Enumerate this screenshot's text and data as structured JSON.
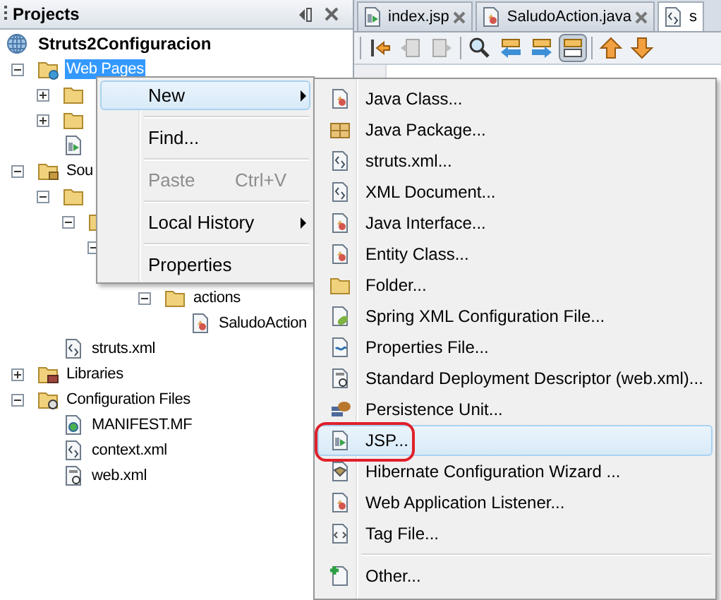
{
  "panel": {
    "title": "Projects"
  },
  "tree": [
    {
      "label": "Struts2Configuracion",
      "kind": "project",
      "selected": false,
      "children": [
        {
          "label": "Web Pages",
          "kind": "web-folder",
          "selected": true,
          "expanded": true,
          "children": [
            {
              "kind": "folder",
              "expanded": false
            },
            {
              "kind": "folder",
              "expanded": false
            },
            {
              "kind": "jsp"
            }
          ]
        },
        {
          "label": "Sou",
          "kind": "source-folder",
          "selected": false,
          "expanded": true,
          "children": [
            {
              "kind": "folder",
              "expanded": true,
              "children": [
                {
                  "kind": "folder",
                  "expanded": true,
                  "children": [
                    {
                      "expanded": true,
                      "children": [
                        {
                          "children": [
                            {
                              "label": "actions",
                              "kind": "folder",
                              "selected": false,
                              "expanded": true,
                              "children": [
                                {
                                  "label": "SaludoAction",
                                  "kind": "java",
                                  "selected": false
                                }
                              ]
                            }
                          ]
                        }
                      ]
                    }
                  ]
                }
              ]
            },
            {
              "label": "struts.xml",
              "kind": "xml",
              "selected": false
            }
          ]
        },
        {
          "label": "Libraries",
          "kind": "libraries",
          "selected": false,
          "expanded": false
        },
        {
          "label": "Configuration Files",
          "kind": "config-folder",
          "selected": false,
          "expanded": true,
          "children": [
            {
              "label": "MANIFEST.MF",
              "kind": "manifest",
              "selected": false
            },
            {
              "label": "context.xml",
              "kind": "xml",
              "selected": false
            },
            {
              "label": "web.xml",
              "kind": "webxml",
              "selected": false
            }
          ]
        }
      ]
    }
  ],
  "editor_tabs": [
    {
      "label": "index.jsp",
      "kind": "jsp",
      "selected": false
    },
    {
      "label": "SaludoAction.java",
      "kind": "java",
      "selected": false
    },
    {
      "label": "s",
      "kind": "xml",
      "selected": true
    }
  ],
  "context_menu": [
    {
      "kind": "item",
      "label": "New",
      "selected": true,
      "has_submenu": true,
      "disabled": false
    },
    {
      "kind": "separator"
    },
    {
      "kind": "item",
      "label": "Find...",
      "selected": false,
      "has_submenu": false,
      "disabled": false
    },
    {
      "kind": "separator"
    },
    {
      "kind": "item",
      "label": "Paste",
      "shortcut": "Ctrl+V",
      "selected": false,
      "has_submenu": false,
      "disabled": true
    },
    {
      "kind": "separator"
    },
    {
      "kind": "item",
      "label": "Local History",
      "selected": false,
      "has_submenu": true,
      "disabled": false
    },
    {
      "kind": "separator"
    },
    {
      "kind": "item",
      "label": "Properties",
      "selected": false,
      "has_submenu": false,
      "disabled": false
    }
  ],
  "new_submenu": [
    {
      "kind": "java",
      "label": "Java Class...",
      "selected": false,
      "circled": false
    },
    {
      "kind": "package",
      "label": "Java Package...",
      "selected": false,
      "circled": false
    },
    {
      "kind": "xml",
      "label": "struts.xml...",
      "selected": false,
      "circled": false
    },
    {
      "kind": "xml",
      "label": "XML Document...",
      "selected": false,
      "circled": false
    },
    {
      "kind": "java",
      "label": "Java Interface...",
      "selected": false,
      "circled": false
    },
    {
      "kind": "java",
      "label": "Entity Class...",
      "selected": false,
      "circled": false
    },
    {
      "kind": "folder",
      "label": "Folder...",
      "selected": false,
      "circled": false
    },
    {
      "kind": "spring",
      "label": "Spring XML Configuration File...",
      "selected": false,
      "circled": false
    },
    {
      "kind": "properties",
      "label": "Properties File...",
      "selected": false,
      "circled": false
    },
    {
      "kind": "webxml",
      "label": "Standard Deployment Descriptor (web.xml)...",
      "selected": false,
      "circled": false
    },
    {
      "kind": "persistence",
      "label": "Persistence Unit...",
      "selected": false,
      "circled": false
    },
    {
      "kind": "jsp",
      "label": "JSP...",
      "selected": true,
      "circled": true
    },
    {
      "kind": "hibernate",
      "label": "Hibernate Configuration Wizard ...",
      "selected": false,
      "circled": false
    },
    {
      "kind": "java",
      "label": "Web Application Listener...",
      "selected": false,
      "circled": false
    },
    {
      "kind": "tag",
      "label": "Tag File...",
      "selected": false,
      "circled": false
    },
    {
      "kind": "separator"
    },
    {
      "kind": "other",
      "label": "Other...",
      "selected": false,
      "circled": false
    }
  ]
}
